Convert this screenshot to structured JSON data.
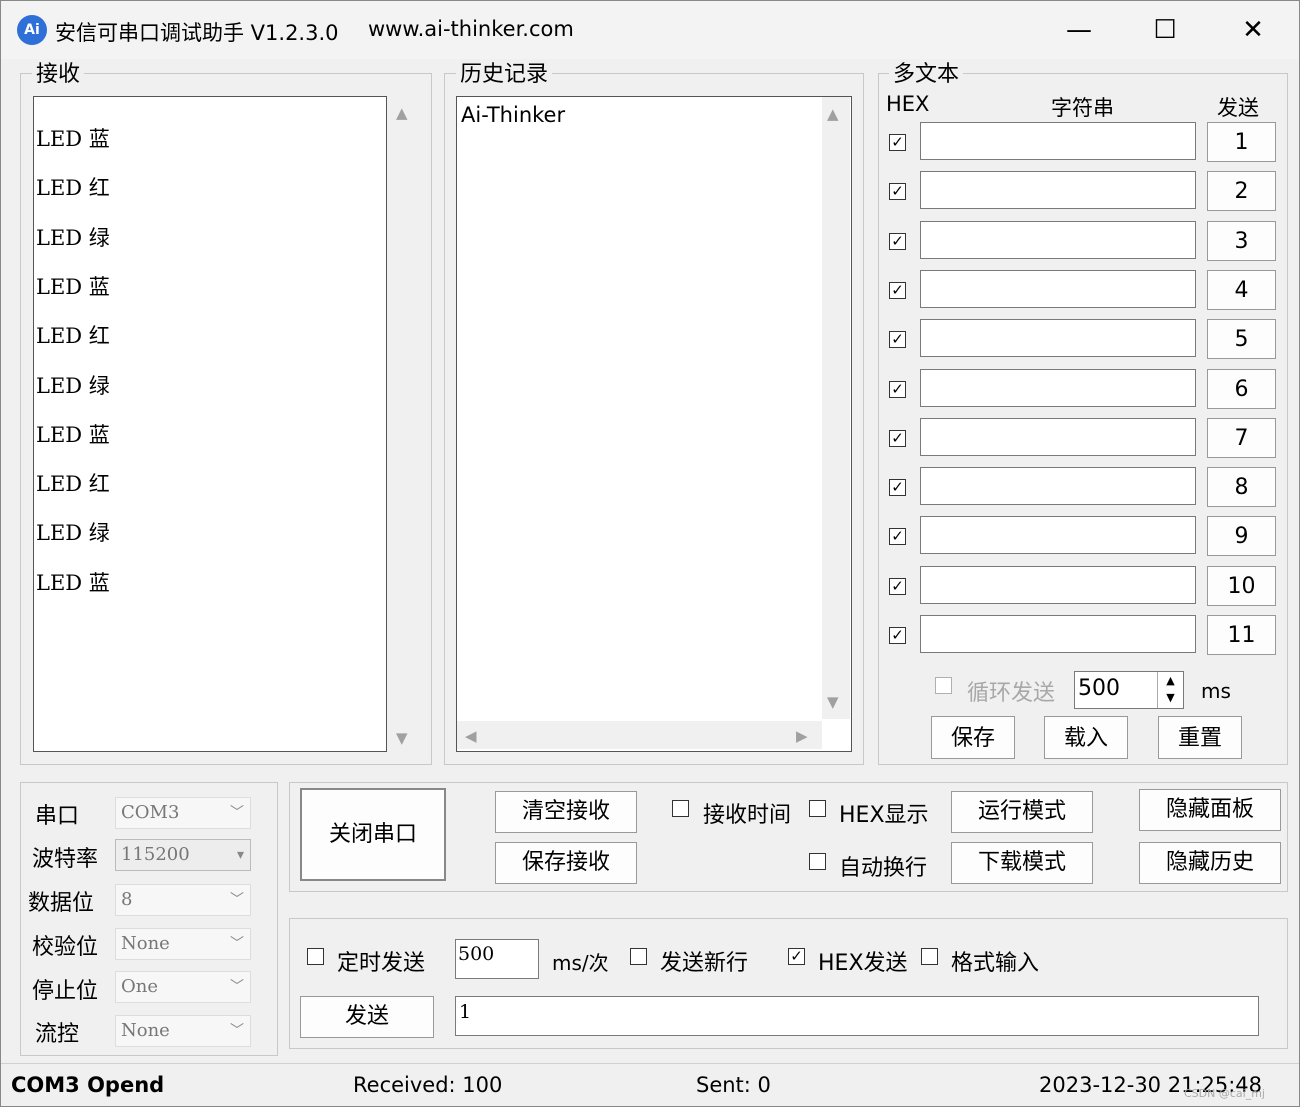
{
  "window": {
    "logo_text": "Ai",
    "title": "安信可串口调试助手 V1.2.3.0",
    "url": "www.ai-thinker.com",
    "controls": {
      "minimize": "—",
      "maximize": "☐",
      "close": "✕"
    }
  },
  "receive": {
    "label": "接收",
    "lines": [
      "LED 蓝",
      "LED 红",
      "LED 绿",
      "LED 蓝",
      "LED 红",
      "LED 绿",
      "LED 蓝",
      "LED 红",
      "LED 绿",
      "LED 蓝"
    ]
  },
  "history": {
    "label": "历史记录",
    "items": [
      "Ai-Thinker"
    ]
  },
  "multitext": {
    "label": "多文本",
    "col_hex": "HEX",
    "col_string": "字符串",
    "col_send": "发送",
    "rows": [
      {
        "hex": true,
        "value": "",
        "button": "1"
      },
      {
        "hex": true,
        "value": "",
        "button": "2"
      },
      {
        "hex": true,
        "value": "",
        "button": "3"
      },
      {
        "hex": true,
        "value": "",
        "button": "4"
      },
      {
        "hex": true,
        "value": "",
        "button": "5"
      },
      {
        "hex": true,
        "value": "",
        "button": "6"
      },
      {
        "hex": true,
        "value": "",
        "button": "7"
      },
      {
        "hex": true,
        "value": "",
        "button": "8"
      },
      {
        "hex": true,
        "value": "",
        "button": "9"
      },
      {
        "hex": true,
        "value": "",
        "button": "10"
      },
      {
        "hex": true,
        "value": "",
        "button": "11"
      }
    ],
    "loop_send_label": "循环发送",
    "loop_send_checked": false,
    "interval": "500",
    "interval_unit": "ms",
    "save": "保存",
    "load": "载入",
    "reset": "重置"
  },
  "serial": {
    "port_label": "串口",
    "port": "COM3",
    "baud_label": "波特率",
    "baud": "115200",
    "data_label": "数据位",
    "data": "8",
    "parity_label": "校验位",
    "parity": "None",
    "stop_label": "停止位",
    "stop": "One",
    "flow_label": "流控",
    "flow": "None"
  },
  "controls": {
    "close_port": "关闭串口",
    "clear_receive": "清空接收",
    "save_receive": "保存接收",
    "receive_time": "接收时间",
    "hex_display": "HEX显示",
    "auto_newline": "自动换行",
    "run_mode": "运行模式",
    "download_mode": "下载模式",
    "hide_panel": "隐藏面板",
    "hide_history": "隐藏历史"
  },
  "send": {
    "timed_send": "定时发送",
    "timed_interval": "500",
    "timed_unit": "ms/次",
    "send_newline": "发送新行",
    "hex_send": "HEX发送",
    "hex_send_checked": true,
    "format_input": "格式输入",
    "send_button": "发送",
    "send_text": "1"
  },
  "status": {
    "port_status": "COM3 Opend",
    "received": "Received: 100",
    "sent": "Sent: 0",
    "datetime": "2023-12-30 21:25:48",
    "watermark": "CSDN @cai_mj"
  },
  "colors": {
    "logo": "#2e6fd8",
    "background": "#f0f0f0"
  }
}
